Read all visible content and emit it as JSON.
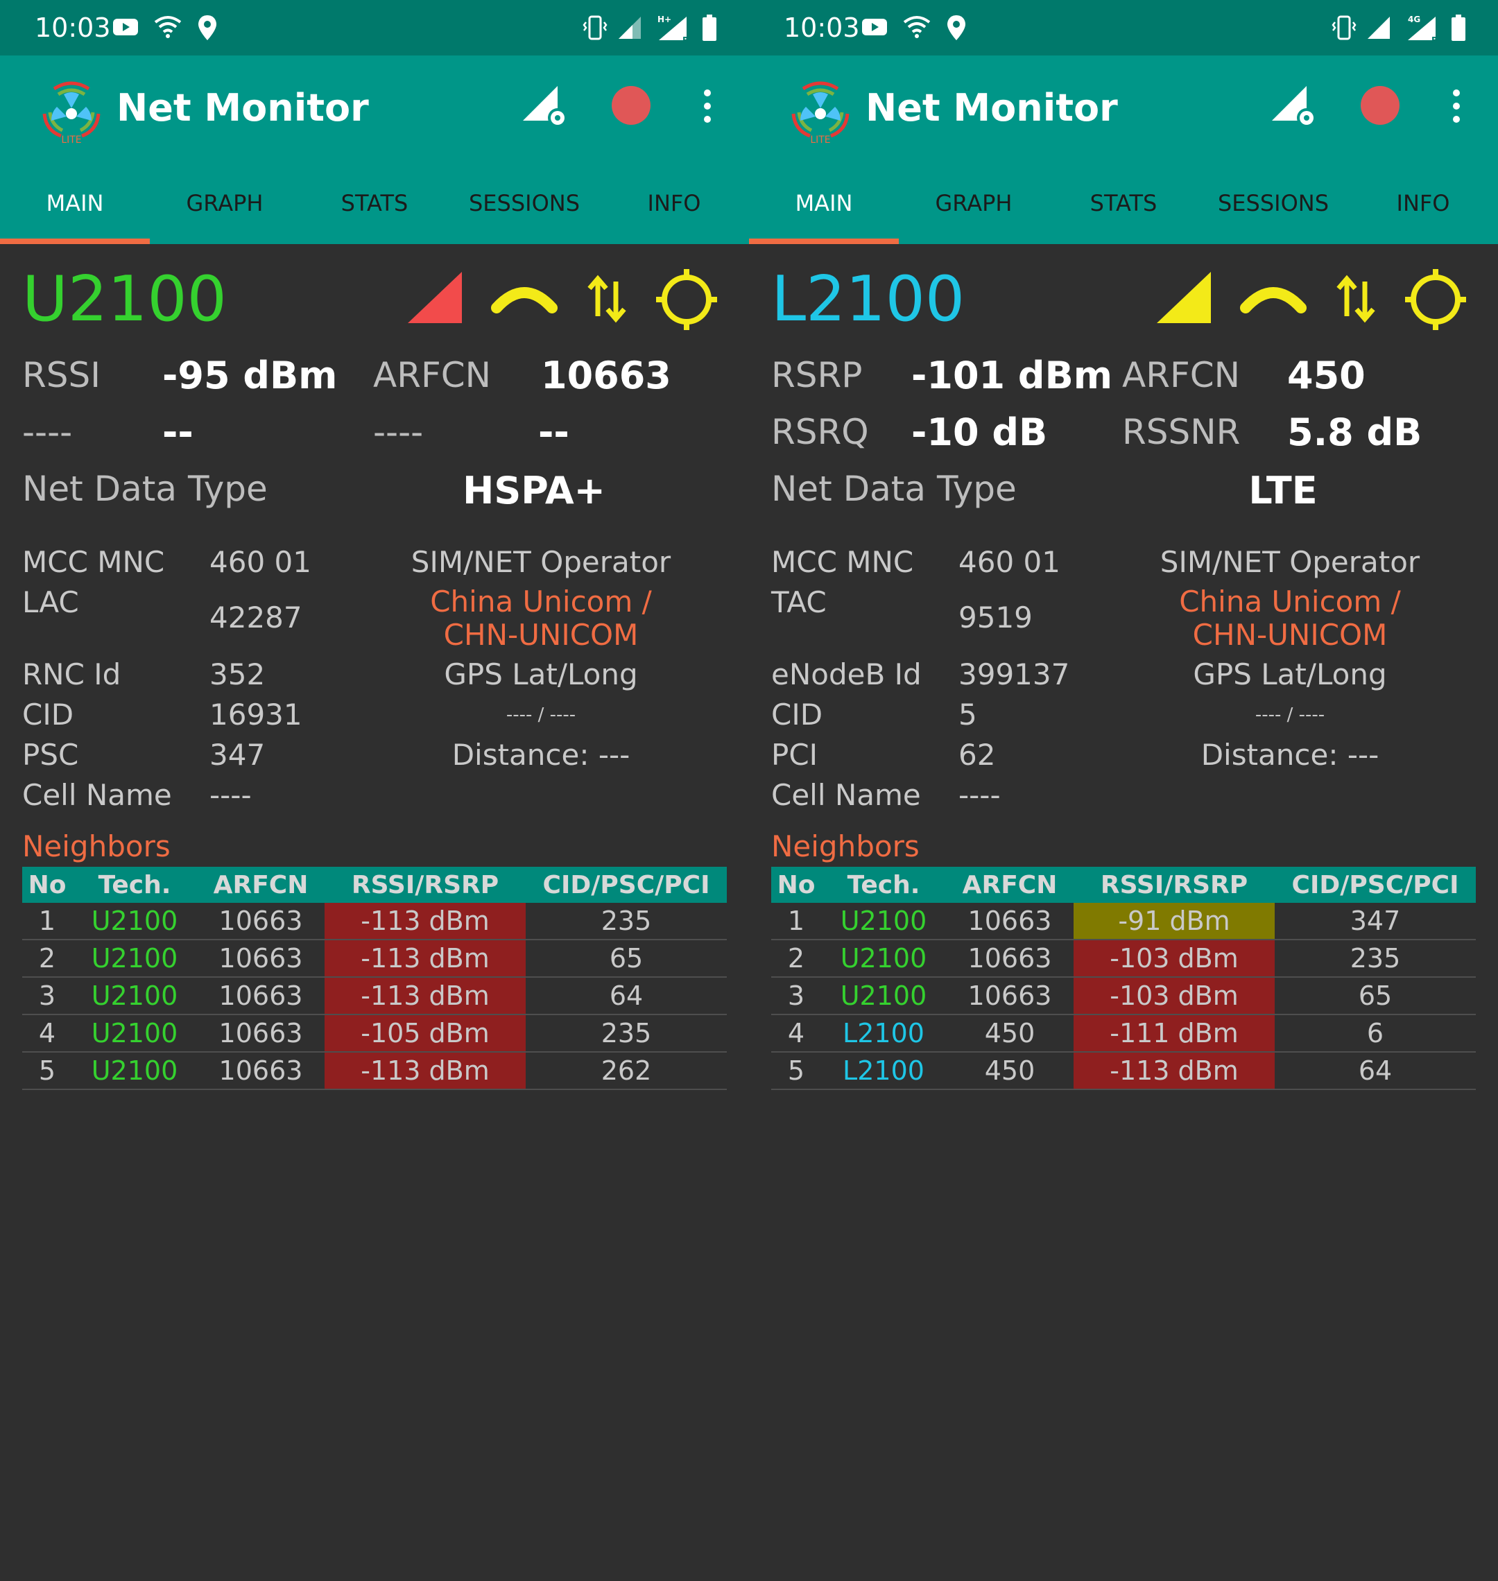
{
  "colors": {
    "status_bar": "#00796b",
    "app_bar": "#009688",
    "tab_indicator": "#f06c43",
    "background": "#2f2f2f",
    "umts_green": "#35d12f",
    "lte_cyan": "#1fc6e6",
    "accent_yellow": "#f3ea18",
    "signal_red": "#f24b4b",
    "operator_orange": "#f06c43",
    "cell_bad": "#8f1f1f",
    "cell_good": "#807a00"
  },
  "left": {
    "status": {
      "time": "10:03",
      "icons": [
        "youtube-icon",
        "wifi-icon",
        "location-icon",
        "vibrate-icon",
        "signal-icon",
        "signal-hplus-icon",
        "battery-icon"
      ],
      "net_badge": "H+",
      "roaming": "R"
    },
    "app": {
      "title": "Net Monitor",
      "logo_badge": "LITE"
    },
    "tabs": [
      "MAIN",
      "GRAPH",
      "STATS",
      "SESSIONS",
      "INFO"
    ],
    "main": {
      "tech": "U2100",
      "row1": {
        "label_a": "RSSI",
        "value_a": "-95 dBm",
        "label_b": "ARFCN",
        "value_b": "10663"
      },
      "row2": {
        "label_a": "----",
        "value_a": "--",
        "label_b": "----",
        "value_b": "--"
      },
      "net_data_type": {
        "label": "Net Data Type",
        "value": "HSPA+"
      },
      "info": {
        "mcc_mnc": {
          "label": "MCC MNC",
          "value": "460 01"
        },
        "area": {
          "label": "LAC",
          "value": "42287"
        },
        "node": {
          "label": "RNC Id",
          "value": "352"
        },
        "cid": {
          "label": "CID",
          "value": "16931"
        },
        "code": {
          "label": "PSC",
          "value": "347"
        },
        "cell_name": {
          "label": "Cell Name",
          "value": "----"
        }
      },
      "sim_net_label": "SIM/NET Operator",
      "operator_line1": "China Unicom /",
      "operator_line2": "CHN-UNICOM",
      "gps_label": "GPS Lat/Long",
      "gps_value": "---- / ----",
      "distance": "Distance: ---"
    },
    "neighbors": {
      "title": "Neighbors",
      "headers": [
        "No",
        "Tech.",
        "ARFCN",
        "RSSI/RSRP",
        "CID/PSC/PCI"
      ],
      "rows": [
        {
          "no": "1",
          "tech": "U2100",
          "arfcn": "10663",
          "rssi": "-113 dBm",
          "cid": "235"
        },
        {
          "no": "2",
          "tech": "U2100",
          "arfcn": "10663",
          "rssi": "-113 dBm",
          "cid": "65"
        },
        {
          "no": "3",
          "tech": "U2100",
          "arfcn": "10663",
          "rssi": "-113 dBm",
          "cid": "64"
        },
        {
          "no": "4",
          "tech": "U2100",
          "arfcn": "10663",
          "rssi": "-105 dBm",
          "cid": "235"
        },
        {
          "no": "5",
          "tech": "U2100",
          "arfcn": "10663",
          "rssi": "-113 dBm",
          "cid": "262"
        }
      ]
    }
  },
  "right": {
    "status": {
      "time": "10:03",
      "icons": [
        "youtube-icon",
        "wifi-icon",
        "location-icon",
        "vibrate-icon",
        "signal-icon",
        "signal-4g-icon",
        "battery-icon"
      ],
      "net_badge": "4G",
      "roaming": "R"
    },
    "app": {
      "title": "Net Monitor",
      "logo_badge": "LITE"
    },
    "tabs": [
      "MAIN",
      "GRAPH",
      "STATS",
      "SESSIONS",
      "INFO"
    ],
    "main": {
      "tech": "L2100",
      "row1": {
        "label_a": "RSRP",
        "value_a": "-101 dBm",
        "label_b": "ARFCN",
        "value_b": "450"
      },
      "row2": {
        "label_a": "RSRQ",
        "value_a": "-10 dB",
        "label_b": "RSSNR",
        "value_b": "5.8 dB"
      },
      "net_data_type": {
        "label": "Net Data Type",
        "value": "LTE"
      },
      "info": {
        "mcc_mnc": {
          "label": "MCC MNC",
          "value": "460 01"
        },
        "area": {
          "label": "TAC",
          "value": "9519"
        },
        "node": {
          "label": "eNodeB Id",
          "value": "399137"
        },
        "cid": {
          "label": "CID",
          "value": "5"
        },
        "code": {
          "label": "PCI",
          "value": "62"
        },
        "cell_name": {
          "label": "Cell Name",
          "value": "----"
        }
      },
      "sim_net_label": "SIM/NET Operator",
      "operator_line1": "China Unicom /",
      "operator_line2": "CHN-UNICOM",
      "gps_label": "GPS Lat/Long",
      "gps_value": "---- / ----",
      "distance": "Distance: ---"
    },
    "neighbors": {
      "title": "Neighbors",
      "headers": [
        "No",
        "Tech.",
        "ARFCN",
        "RSSI/RSRP",
        "CID/PSC/PCI"
      ],
      "rows": [
        {
          "no": "1",
          "tech": "U2100",
          "arfcn": "10663",
          "rssi": "-91 dBm",
          "cid": "347"
        },
        {
          "no": "2",
          "tech": "U2100",
          "arfcn": "10663",
          "rssi": "-103 dBm",
          "cid": "235"
        },
        {
          "no": "3",
          "tech": "U2100",
          "arfcn": "10663",
          "rssi": "-103 dBm",
          "cid": "65"
        },
        {
          "no": "4",
          "tech": "L2100",
          "arfcn": "450",
          "rssi": "-111 dBm",
          "cid": "6"
        },
        {
          "no": "5",
          "tech": "L2100",
          "arfcn": "450",
          "rssi": "-113 dBm",
          "cid": "64"
        }
      ]
    }
  }
}
